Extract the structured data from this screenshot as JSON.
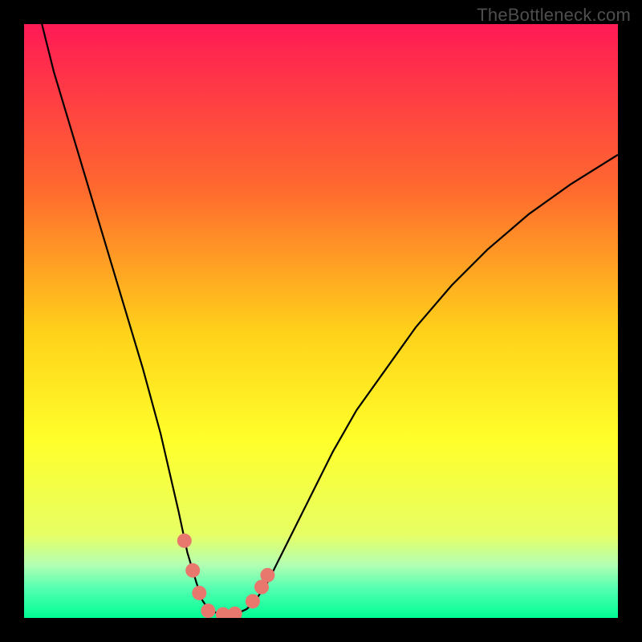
{
  "watermark": "TheBottleneck.com",
  "chart_data": {
    "type": "line",
    "title": "",
    "xlabel": "",
    "ylabel": "",
    "xlim": [
      0,
      100
    ],
    "ylim": [
      0,
      100
    ],
    "grid": false,
    "background_gradient": {
      "stops": [
        {
          "y": 0,
          "color": "#ff1a55"
        },
        {
          "y": 28,
          "color": "#ff6a2e"
        },
        {
          "y": 52,
          "color": "#ffd21a"
        },
        {
          "y": 70,
          "color": "#ffff2a"
        },
        {
          "y": 86,
          "color": "#e7ff65"
        },
        {
          "y": 91,
          "color": "#b4ffb2"
        },
        {
          "y": 95,
          "color": "#55ffb2"
        },
        {
          "y": 100,
          "color": "#00fd93"
        }
      ]
    },
    "series": [
      {
        "name": "curve",
        "x": [
          3.0,
          5.0,
          8.0,
          11.0,
          14.0,
          17.0,
          20.0,
          23.0,
          26.0,
          27.5,
          29.0,
          30.0,
          31.0,
          32.5,
          34.0,
          36.0,
          37.5,
          39.0,
          41.0,
          44.0,
          48.0,
          52.0,
          56.0,
          61.0,
          66.0,
          72.0,
          78.0,
          85.0,
          92.0,
          100.0
        ],
        "y": [
          100.0,
          92.0,
          82.0,
          72.0,
          62.0,
          52.0,
          42.0,
          31.0,
          18.0,
          11.0,
          6.0,
          3.0,
          1.5,
          0.8,
          0.6,
          0.8,
          1.5,
          3.0,
          6.0,
          12.0,
          20.0,
          28.0,
          35.0,
          42.0,
          49.0,
          56.0,
          62.0,
          68.0,
          73.0,
          78.0
        ]
      }
    ],
    "markers": [
      {
        "x": 27.0,
        "y": 13.0
      },
      {
        "x": 28.4,
        "y": 8.0
      },
      {
        "x": 29.5,
        "y": 4.2
      },
      {
        "x": 31.0,
        "y": 1.2
      },
      {
        "x": 33.5,
        "y": 0.6
      },
      {
        "x": 35.5,
        "y": 0.7
      },
      {
        "x": 38.5,
        "y": 2.8
      },
      {
        "x": 40.0,
        "y": 5.2
      },
      {
        "x": 41.0,
        "y": 7.2
      }
    ],
    "marker_style": {
      "color": "#e8776e",
      "radius": 9
    },
    "line_style": {
      "color": "#000000",
      "width": 2.2
    }
  }
}
